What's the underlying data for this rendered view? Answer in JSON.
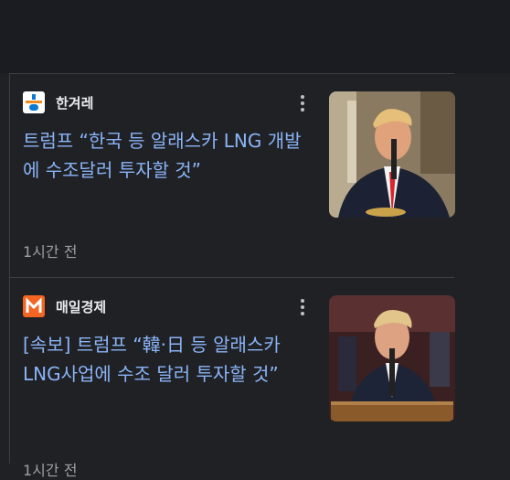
{
  "articles": [
    {
      "source": "한겨레",
      "source_icon": "hankyoreh-logo-icon",
      "headline": "트럼프 “한국 등 알래스카 LNG 개발에 수조달러 투자할 것”",
      "time": "1시간 전"
    },
    {
      "source": "매일경제",
      "source_icon": "maeil-logo-icon",
      "headline": "[속보] 트럼프 “韓·日 등 알래스카 LNG사업에 수조 달러 투자할 것”",
      "time": "1시간 전"
    }
  ],
  "colors": {
    "headline": "#8ab4f8",
    "source_text": "#e8eaed",
    "time_text": "#9aa0a6",
    "background": "#202124"
  }
}
